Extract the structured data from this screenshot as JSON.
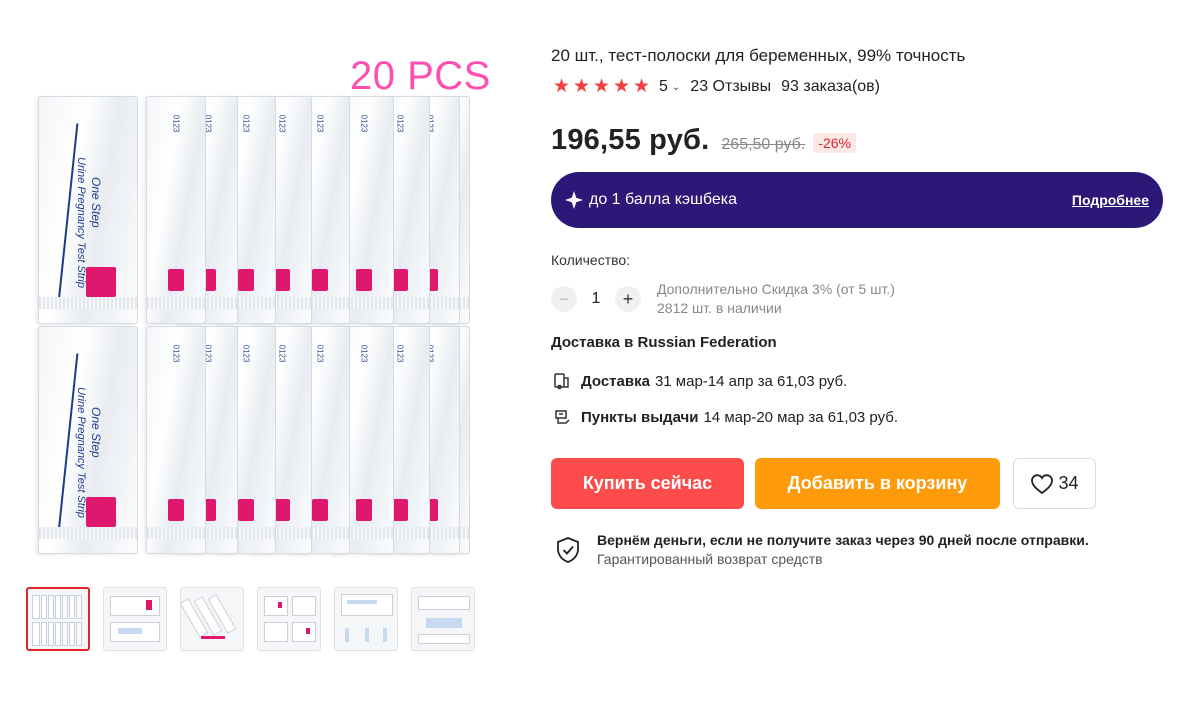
{
  "gallery": {
    "pcs_label": "20 PCS",
    "strip_code": "0123",
    "front_line1": "One Step",
    "front_line2": "Urine Pregnancy Test Strip",
    "thumbnail_count": 6,
    "active_thumbnail": 0
  },
  "product": {
    "title": "20 шт., тест-полоски для беременных, 99% точность",
    "rating": "5",
    "stars": 5,
    "reviews": "23 Отзывы",
    "orders": "93 заказа(ов)"
  },
  "price": {
    "current": "196,55 руб.",
    "old": "265,50 руб.",
    "discount": "-26%"
  },
  "cashback": {
    "text": "до 1 балла кэшбека",
    "more_label": "Подробнее"
  },
  "quantity": {
    "label": "Количество:",
    "value": "1",
    "minus": "−",
    "plus": "+",
    "extra_discount": "Дополнительно Скидка 3% (от 5 шт.)",
    "stock": "2812 шт. в наличии"
  },
  "delivery": {
    "title": "Доставка в Russian Federation",
    "courier_label": "Доставка",
    "courier_detail": "31 мар-14 апр за 61,03 руб.",
    "pickup_label": "Пункты выдачи",
    "pickup_detail": "14 мар-20 мар за 61,03 руб."
  },
  "actions": {
    "buy_now": "Купить сейчас",
    "add_to_cart": "Добавить в корзину",
    "wishlist_count": "34"
  },
  "guarantee": {
    "line1": "Вернём деньги, если не получите заказ через 90 дней после отправки.",
    "line2": "Гарантированный возврат средств"
  },
  "colors": {
    "accent_red": "#fe4b4b",
    "accent_orange": "#ff9a0a",
    "cashback_bg": "#2c1877",
    "star": "#f43e3e",
    "pcs_pink": "#ff4fb0"
  }
}
